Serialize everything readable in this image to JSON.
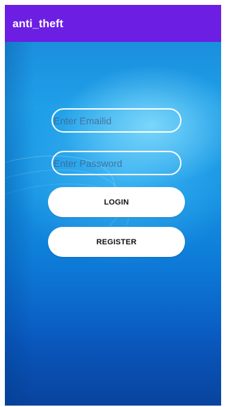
{
  "app_bar": {
    "title": "anti_theft",
    "color": "#6c1fe3"
  },
  "login_form": {
    "email_placeholder": "Enter Emailid",
    "password_placeholder": "Enter Password",
    "login_label": "LOGIN",
    "register_label": "REGISTER"
  },
  "theme": {
    "background_blue": "#1b8fdd",
    "button_background": "#ffffff",
    "input_border": "#ffffff"
  }
}
